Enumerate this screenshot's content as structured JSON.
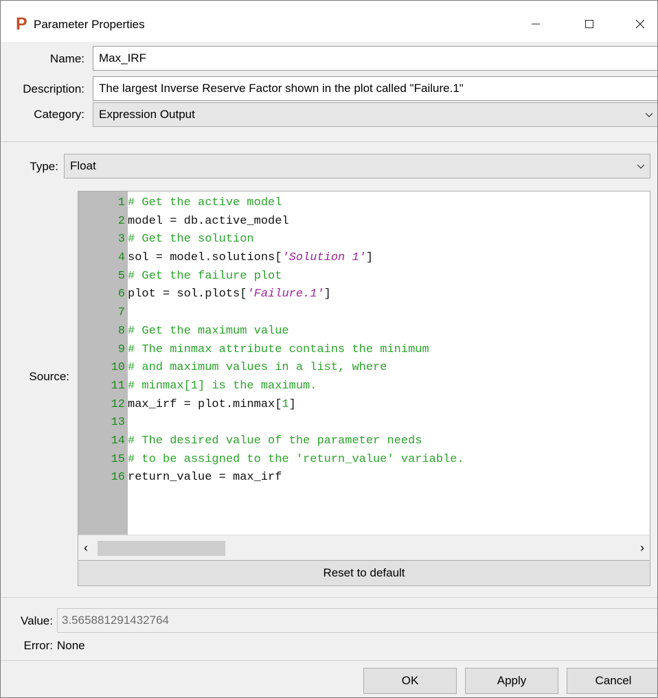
{
  "window": {
    "title": "Parameter Properties",
    "app_icon_letter": "P",
    "accent_color": "#c0502a"
  },
  "fields": {
    "name_label": "Name:",
    "name_value": "Max_IRF",
    "description_label": "Description:",
    "description_value": "The largest Inverse Reserve Factor shown in the plot called \"Failure.1\"",
    "category_label": "Category:",
    "category_value": "Expression Output",
    "type_label": "Type:",
    "type_value": "Float",
    "source_label": "Source:"
  },
  "source": {
    "lines": [
      {
        "n": "1",
        "tokens": [
          {
            "t": "# Get the active model",
            "k": "comment"
          }
        ]
      },
      {
        "n": "2",
        "tokens": [
          {
            "t": "model = db.active_model",
            "k": "plain"
          }
        ]
      },
      {
        "n": "3",
        "tokens": [
          {
            "t": "# Get the solution",
            "k": "comment"
          }
        ]
      },
      {
        "n": "4",
        "tokens": [
          {
            "t": "sol = model.solutions[",
            "k": "plain"
          },
          {
            "t": "'Solution 1'",
            "k": "string"
          },
          {
            "t": "]",
            "k": "plain"
          }
        ]
      },
      {
        "n": "5",
        "tokens": [
          {
            "t": "# Get the failure plot",
            "k": "comment"
          }
        ]
      },
      {
        "n": "6",
        "tokens": [
          {
            "t": "plot = sol.plots[",
            "k": "plain"
          },
          {
            "t": "'Failure.1'",
            "k": "string"
          },
          {
            "t": "]",
            "k": "plain"
          }
        ]
      },
      {
        "n": "7",
        "tokens": []
      },
      {
        "n": "8",
        "tokens": [
          {
            "t": "# Get the maximum value",
            "k": "comment"
          }
        ]
      },
      {
        "n": "9",
        "tokens": [
          {
            "t": "# The minmax attribute contains the minimum",
            "k": "comment"
          }
        ]
      },
      {
        "n": "10",
        "tokens": [
          {
            "t": "# and maximum values in a list, where",
            "k": "comment"
          }
        ]
      },
      {
        "n": "11",
        "tokens": [
          {
            "t": "# minmax[1] is the maximum.",
            "k": "comment"
          }
        ]
      },
      {
        "n": "12",
        "tokens": [
          {
            "t": "max_irf = plot.minmax[",
            "k": "plain"
          },
          {
            "t": "1",
            "k": "num"
          },
          {
            "t": "]",
            "k": "plain"
          }
        ]
      },
      {
        "n": "13",
        "tokens": []
      },
      {
        "n": "14",
        "tokens": [
          {
            "t": "# The desired value of the parameter needs",
            "k": "comment"
          }
        ]
      },
      {
        "n": "15",
        "tokens": [
          {
            "t": "# to be assigned to the 'return_value' variable.",
            "k": "comment"
          }
        ]
      },
      {
        "n": "16",
        "tokens": [
          {
            "t": "return_value = max_irf",
            "k": "plain"
          }
        ]
      }
    ]
  },
  "reset_label": "Reset to default",
  "result": {
    "value_label": "Value:",
    "value": "3.565881291432764",
    "error_label": "Error:",
    "error_value": "None"
  },
  "buttons": {
    "ok": "OK",
    "apply": "Apply",
    "cancel": "Cancel"
  }
}
